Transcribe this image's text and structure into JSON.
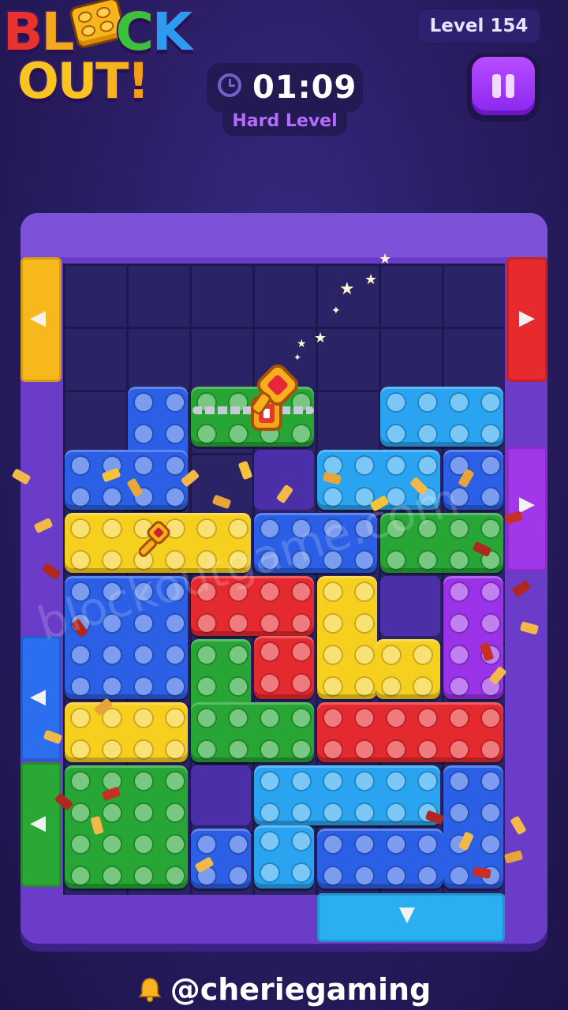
{
  "logo": {
    "line1": [
      "B",
      "L",
      "O",
      "C",
      "K"
    ],
    "line2": [
      "O",
      "U",
      "T",
      "!"
    ],
    "line1_colors": [
      "#e8322c",
      "#f2a81d",
      "#f7c421",
      "#3cc23a",
      "#2d9cf0"
    ],
    "line2_colors": [
      "#f7c421",
      "#f7c421",
      "#f7b31a",
      "#f29f16"
    ]
  },
  "header": {
    "level_label": "Level 154",
    "timer": "01:09",
    "difficulty": "Hard Level"
  },
  "icons": {
    "clock": "clock-icon",
    "pause": "pause-icon",
    "key": "key-icon",
    "bell": "bell-icon"
  },
  "colors": {
    "background": "#2a1d63",
    "board_frame": "#6a3cc8",
    "blue": "#2b5fe6",
    "light_blue": "#2aa4f0",
    "green": "#27a636",
    "yellow": "#f7cf1f",
    "red": "#e52a2f",
    "purple": "#9a33e8"
  },
  "gates": [
    {
      "side": "left",
      "color": "yellow",
      "arrow": "◀"
    },
    {
      "side": "right",
      "color": "red",
      "arrow": "▶"
    },
    {
      "side": "right",
      "color": "purple",
      "arrow": "▶"
    },
    {
      "side": "left",
      "color": "blue",
      "arrow": "◀"
    },
    {
      "side": "left",
      "color": "green",
      "arrow": "◀"
    },
    {
      "side": "bottom",
      "color": "light_blue",
      "arrow": "▼"
    }
  ],
  "watermark": "blockoutgame.com",
  "footer": {
    "handle": "@cheriegaming"
  }
}
